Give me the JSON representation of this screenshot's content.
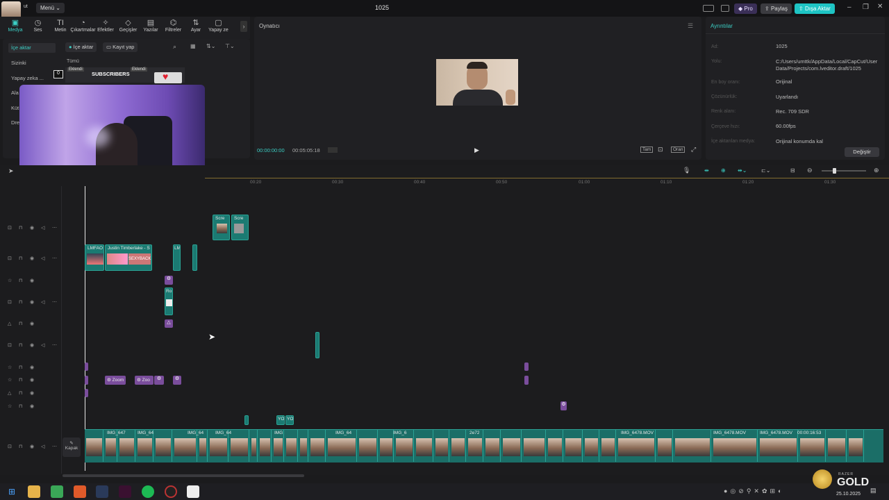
{
  "titlebar": {
    "menu": "Menü ⌄",
    "project": "1025",
    "pro": "Pro",
    "share": "Paylaş",
    "export": "Dışa Aktar",
    "small_label": "ut"
  },
  "tools": [
    {
      "label": "Medya",
      "icon": "media-icon"
    },
    {
      "label": "Ses",
      "icon": "audio-icon"
    },
    {
      "label": "Metin",
      "icon": "text-icon"
    },
    {
      "label": "Çıkartmalar",
      "icon": "sticker-icon"
    },
    {
      "label": "Efektler",
      "icon": "effects-icon"
    },
    {
      "label": "Geçişler",
      "icon": "transitions-icon"
    },
    {
      "label": "Yazılar",
      "icon": "captions-icon"
    },
    {
      "label": "Filtreler",
      "icon": "filters-icon"
    },
    {
      "label": "Ayar",
      "icon": "adjust-icon"
    },
    {
      "label": "Yapay ze",
      "icon": "ai-icon"
    }
  ],
  "left": {
    "sidebar": [
      "İçe aktar",
      "Sizinki",
      "Yapay zeka ...",
      "Ala",
      "Küt",
      "Dre"
    ],
    "import_btn": "İçe aktar",
    "record_btn": "Kayıt yap",
    "filter_all": "Tümü",
    "thumb_subscribers": "SUBSCRIBERS",
    "thumb_added1": "Eklendi",
    "thumb_added2": "Eklendi",
    "thumb_zero": "0"
  },
  "player": {
    "title": "Oynatıcı",
    "current": "00:00:00:00",
    "total": "00:05:05:18",
    "full": "Tam",
    "ratio": "Oran"
  },
  "details": {
    "title": "Ayrıntılar",
    "rows": [
      {
        "k": "Ad:",
        "v": "1025"
      },
      {
        "k": "Yolu:",
        "v": "C:/Users/umttk/AppData/Local/CapCut/User Data/Projects/com.lveditor.draft/1025"
      },
      {
        "k": "En boy oranı:",
        "v": "Orijinal"
      },
      {
        "k": "Çözünürlük:",
        "v": "Uyarlandı"
      },
      {
        "k": "Renk alanı:",
        "v": "Rec. 709 SDR"
      },
      {
        "k": "Çerçeve hızı:",
        "v": "60.00fps"
      },
      {
        "k": "İçe aktarılan medya:",
        "v": "Orijinal konumda kal"
      }
    ],
    "change": "Değiştir"
  },
  "ruler": [
    "00:20",
    "00:30",
    "00:40",
    "00:50",
    "01:00",
    "01:10",
    "01:20",
    "01:30"
  ],
  "timeline": {
    "cover": "Kapak",
    "clips": {
      "scr1": "Scre",
      "scr2": "Scre",
      "lmfao": "LMFAO",
      "justin": "Justin Timberlake - S",
      "sexy": "SEXYBACK",
      "lm2": "LM",
      "ro": "Ro",
      "zoom1": "Zoom",
      "zoom2": "Zoo",
      "yo1": "YO",
      "yo2": "YO",
      "main": [
        "IMG_647",
        "IMG_64",
        "IMG",
        "IMG_64",
        "IMG_64",
        "IMG",
        "IMG_64",
        "IMG_6",
        "IMG_6",
        "2e72",
        "IMG_6478.MOV",
        "IMG_6478.MOV",
        "IMG_6478.MOV",
        "00:00:16:53"
      ]
    }
  },
  "taskbar": {
    "date": "25.10.2025",
    "gold": "GOLD",
    "razer": "RAZER"
  }
}
